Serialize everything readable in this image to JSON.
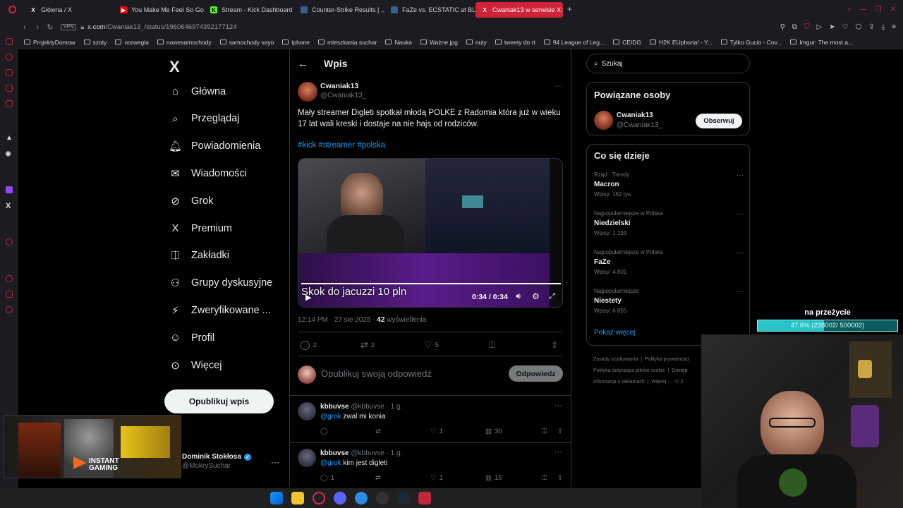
{
  "browser": {
    "tabs": [
      {
        "label": "Główna / X",
        "icon": "x-logo-icon"
      },
      {
        "label": "You Make Me Feel So Go...",
        "icon": "youtube-icon"
      },
      {
        "label": "Stream - Kick Dashboard",
        "icon": "kick-icon"
      },
      {
        "label": "Counter-Strike Results | ...",
        "icon": "hltv-icon"
      },
      {
        "label": "FaZe vs. ECSTATIC at BL...",
        "icon": "hltv-icon"
      },
      {
        "label": "Cwaniak13 w serwisie X: ...",
        "icon": "x-logo-icon",
        "active": true
      }
    ],
    "url_host": "x.com",
    "url_path": "/Cwaniak13_/status/1960646974392177124",
    "vpn_label": "VPN",
    "bookmarks": [
      "ProjektyDomow",
      "szoty",
      "norwegia",
      "nowesamochody",
      "samochody xayo",
      "iphone",
      "mieszkania suchar",
      "Nauka",
      "Ważne jpg",
      "nuty",
      "tweety do rt",
      "94 League of Leg...",
      "CEIDG",
      "H2K EUphoria! - Y...",
      "Tylko Gucio - Cov...",
      "Imgur: The most a..."
    ]
  },
  "nav": {
    "items": [
      {
        "label": "Główna",
        "icon": "home-icon"
      },
      {
        "label": "Przeglądaj",
        "icon": "search-icon"
      },
      {
        "label": "Powiadomienia",
        "icon": "bell-icon"
      },
      {
        "label": "Wiadomości",
        "icon": "mail-icon"
      },
      {
        "label": "Grok",
        "icon": "grok-icon"
      },
      {
        "label": "Premium",
        "icon": "x-logo-icon"
      },
      {
        "label": "Zakładki",
        "icon": "bookmark-icon"
      },
      {
        "label": "Grupy dyskusyjne",
        "icon": "people-icon"
      },
      {
        "label": "Zweryfikowane ...",
        "icon": "bolt-icon"
      },
      {
        "label": "Profil",
        "icon": "person-icon"
      },
      {
        "label": "Więcej",
        "icon": "more-icon"
      }
    ],
    "post_button": "Opublikuj wpis",
    "account": {
      "name": "Dominik Stokłosa",
      "handle": "@MokrySuchar"
    }
  },
  "post": {
    "header_title": "Wpis",
    "author_name": "Cwaniak13",
    "author_handle": "@Cwaniak13_",
    "text": "Mały streamer Digleti spotkał młodą POLKE z Radomia która już w wieku 17 lat wali kreski i dostaje na nie hajs od rodziców.",
    "tags": "#kick #streamer #polska",
    "video": {
      "caption": "Skok do jacuzzi 10 pln",
      "time": "0:34 / 0:34",
      "progress": 1.0
    },
    "timestamp": "12:14 PM · 27 sie 2025 · ",
    "views_count": "42",
    "views_label": " wyświetlenia",
    "stats": {
      "replies": "2",
      "reposts": "2",
      "likes": "5"
    },
    "reply_placeholder": "Opublikuj swoją odpowiedź",
    "reply_button": "Odpowiedz"
  },
  "replies": [
    {
      "name": "kbbuvse",
      "handle": "@kbbuvse · 1 g.",
      "mention": "@grok",
      "text": " zwal mi konia",
      "replies": "",
      "reposts": "",
      "likes": "1",
      "views": "30"
    },
    {
      "name": "kbbuvse",
      "handle": "@kbbuvse · 1 g.",
      "mention": "@grok",
      "text": " kim jest digleti",
      "replies": "1",
      "reposts": "",
      "likes": "1",
      "views": "15"
    }
  ],
  "right": {
    "search_placeholder": "Szukaj",
    "related_title": "Powiązane osoby",
    "related": {
      "name": "Cwaniak13",
      "handle": "@Cwaniak13_",
      "follow": "Obserwuj"
    },
    "trends_title": "Co się dzieje",
    "trends": [
      {
        "context": "Rząd · Trendy",
        "name": "Macron",
        "count": "Wpisy: 162 tys."
      },
      {
        "context": "Najpopularniejsze w Polska",
        "name": "Niedzielski",
        "count": "Wpisy: 1 193"
      },
      {
        "context": "Najpopularniejsze w Polska",
        "name": "FaZe",
        "count": "Wpisy: 4 801"
      },
      {
        "context": "Najpopularniejsze",
        "name": "Niestety",
        "count": "Wpisy: 6 855"
      }
    ],
    "show_more": "Pokaż więcej",
    "footer": [
      "Zasady użytkowania",
      "Polityka prywatności",
      "Polityka dotycząca plików cookie",
      "Dostęp",
      "Informacja o reklamach",
      "Więcej ···",
      "© 2"
    ]
  },
  "overlay": {
    "goal_title": "na przeżycie",
    "goal_text": "47.6% (238002/ 500002)",
    "goal_fraction": 0.476,
    "ad_text": "INSTANT\nGAMING"
  }
}
